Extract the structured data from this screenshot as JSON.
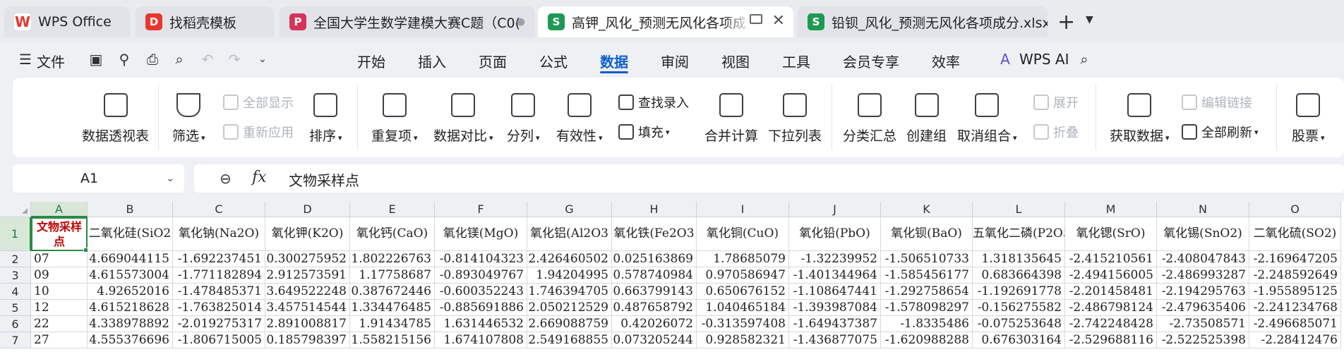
{
  "tabs": [
    {
      "label": "WPS Office",
      "icon": "W",
      "color": "#e8372c"
    },
    {
      "label": "找稻壳模板",
      "icon": "D",
      "color": "#e8372c"
    },
    {
      "label": "全国大学生数学建模大赛C题（C0(",
      "icon": "P",
      "color": "#d6335a"
    },
    {
      "label": "高钾_风化_预测无风化各项成分",
      "icon": "S",
      "color": "#1d9a52"
    },
    {
      "label": "铅钡_风化_预测无风化各项成分.xlsx",
      "icon": "S",
      "color": "#1d9a52"
    }
  ],
  "menubar": {
    "file": "文件",
    "items": [
      "开始",
      "插入",
      "页面",
      "公式",
      "数据",
      "审阅",
      "视图",
      "工具",
      "会员专享",
      "效率"
    ],
    "active": "数据",
    "ai": "WPS AI"
  },
  "ribbon": {
    "pivot": "数据透视表",
    "filter": "筛选",
    "show_all": "全部显示",
    "reapply": "重新应用",
    "sort": "排序",
    "duplicates": "重复项",
    "compare": "数据对比",
    "split": "分列",
    "validity": "有效性",
    "lookup": "查找录入",
    "fill": "填充",
    "consolidate": "合并计算",
    "dropdown": "下拉列表",
    "subtotal": "分类汇总",
    "group": "创建组",
    "ungroup": "取消组合",
    "expand": "展开",
    "collapse": "折叠",
    "get_data": "获取数据",
    "edit_links": "编辑链接",
    "refresh_all": "全部刷新",
    "stocks": "股票"
  },
  "formula_bar": {
    "cell_ref": "A1",
    "fx": "fx",
    "value": "文物采样点"
  },
  "grid": {
    "columns": [
      "A",
      "B",
      "C",
      "D",
      "E",
      "F",
      "G",
      "H",
      "I",
      "J",
      "K",
      "L",
      "M",
      "N",
      "O"
    ],
    "rows": [
      "1",
      "2",
      "3",
      "4",
      "5",
      "6",
      "7"
    ],
    "a1_lines": [
      "文物采样",
      "点"
    ],
    "headers": [
      "二氧化硅(SiO2",
      "氧化钠(Na2O)",
      "氧化钾(K2O)",
      "氧化钙(CaO)",
      "氧化镁(MgO)",
      "氧化铝(Al2O3",
      "氧化铁(Fe2O3",
      "氧化铜(CuO)",
      "氧化铅(PbO)",
      "氧化钡(BaO)",
      "五氧化二磷(P2O5",
      "氧化锶(SrO)",
      "氧化锡(SnO2)",
      "二氧化硫(SO2)"
    ],
    "data": [
      [
        "07",
        "4.669044115",
        "-1.692237451",
        "0.300275952",
        "1.802226763",
        "-0.814104323",
        "2.426460502",
        "0.025163869",
        "1.78685079",
        "-1.32239952",
        "-1.506510733",
        "1.318135645",
        "-2.415210561",
        "-2.408047843",
        "-2.169647205"
      ],
      [
        "09",
        "4.615573004",
        "-1.771182894",
        "2.912573591",
        "1.17758687",
        "-0.893049767",
        "1.94204995",
        "0.578740984",
        "0.970586947",
        "-1.401344964",
        "-1.585456177",
        "0.683664398",
        "-2.494156005",
        "-2.486993287",
        "-2.248592649"
      ],
      [
        "10",
        "4.92652016",
        "-1.478485371",
        "3.649522248",
        "0.387672446",
        "-0.600352243",
        "1.746394705",
        "0.663799143",
        "0.650676152",
        "-1.108647441",
        "-1.292758654",
        "-1.192691778",
        "-2.201458481",
        "-2.194295763",
        "-1.955895125"
      ],
      [
        "12",
        "4.615218628",
        "-1.763825014",
        "3.457514544",
        "1.334476485",
        "-0.885691886",
        "2.050212529",
        "0.487658792",
        "1.040465184",
        "-1.393987084",
        "-1.578098297",
        "-0.156275582",
        "-2.486798124",
        "-2.479635406",
        "-2.241234768"
      ],
      [
        "22",
        "4.338978892",
        "-2.019275317",
        "2.891008817",
        "1.91434785",
        "1.631446532",
        "2.669088759",
        "0.42026072",
        "-0.313597408",
        "-1.649437387",
        "-1.8335486",
        "-0.075253648",
        "-2.742248428",
        "-2.73508571",
        "-2.496685071"
      ],
      [
        "27",
        "4.555376696",
        "-1.806715005",
        "0.185798397",
        "1.558215156",
        "1.674107808",
        "2.549168855",
        "0.073205244",
        "0.928582321",
        "-1.436877075",
        "-1.620988288",
        "0.676303164",
        "-2.529688116",
        "-2.522525398",
        "-2.28412476"
      ]
    ]
  }
}
